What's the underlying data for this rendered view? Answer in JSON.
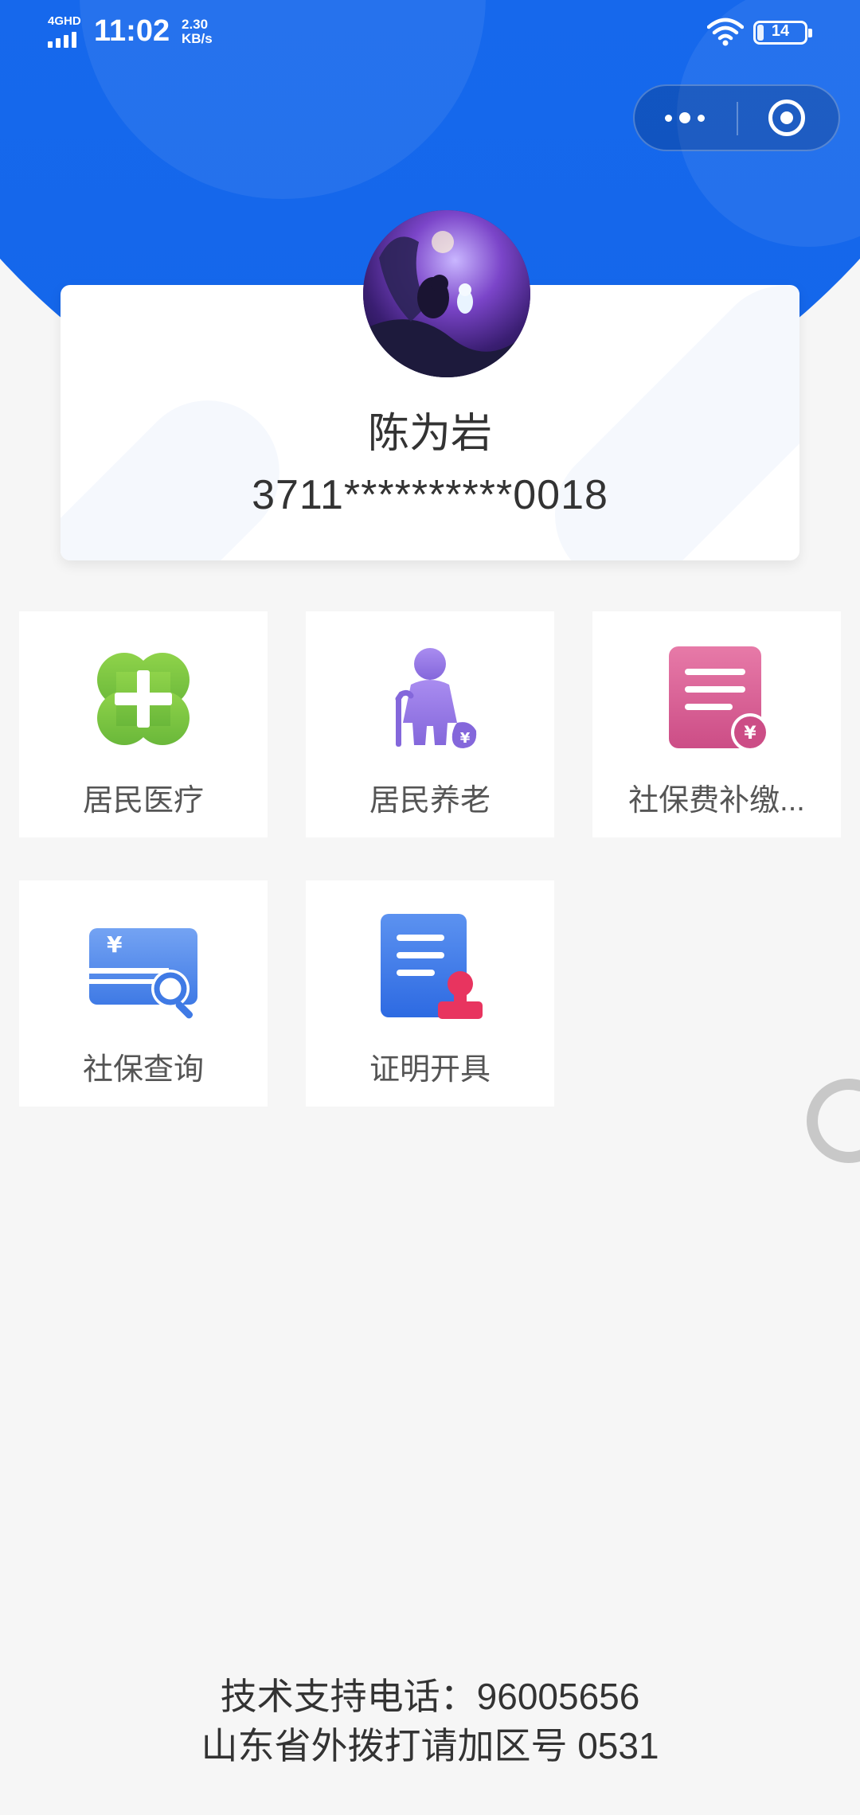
{
  "status_bar": {
    "network": "4GHD",
    "time": "11:02",
    "speed_value": "2.30",
    "speed_unit": "KB/s",
    "battery": "14"
  },
  "profile": {
    "name": "陈为岩",
    "id_number": "3711**********0018"
  },
  "services": [
    {
      "label": "居民医疗",
      "icon": "medical-cross-icon",
      "color": "#7cc63f"
    },
    {
      "label": "居民养老",
      "icon": "elderly-pension-icon",
      "color": "#9a7de6"
    },
    {
      "label": "社保费补缴...",
      "icon": "payment-bill-icon",
      "color": "#d9558b"
    },
    {
      "label": "社保查询",
      "icon": "card-search-icon",
      "color": "#3e7be8"
    },
    {
      "label": "证明开具",
      "icon": "certificate-stamp-icon",
      "color": "#3170e6"
    }
  ],
  "footer": {
    "support_phone": "技术支持电话：96005656",
    "area_code_note": "山东省外拨打请加区号 0531"
  },
  "colors": {
    "header_blue": "#1a6ef2",
    "page_bg": "#f6f6f6"
  }
}
